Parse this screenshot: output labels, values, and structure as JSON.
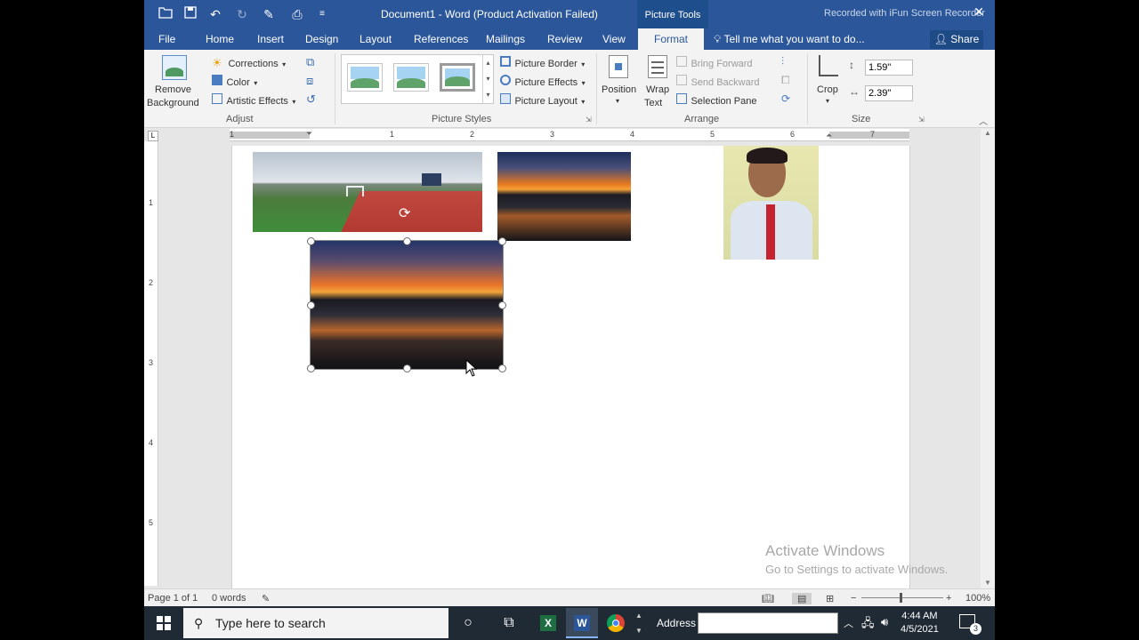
{
  "window": {
    "title": "Document1 - Word (Product Activation Failed)",
    "context_tab_group": "Picture Tools",
    "recorder_overlay": "Recorded with iFun Screen Recorder",
    "close_glyph": "✕"
  },
  "tabs": [
    "File",
    "Home",
    "Insert",
    "Design",
    "Layout",
    "References",
    "Mailings",
    "Review",
    "View",
    "Format"
  ],
  "tell_me": "Tell me what you want to do...",
  "share": "Share",
  "ribbon": {
    "remove_background": [
      "Remove",
      "Background"
    ],
    "corrections": "Corrections",
    "color": "Color",
    "artistic_effects": "Artistic Effects",
    "adjust_label": "Adjust",
    "picture_border": "Picture Border",
    "picture_effects": "Picture Effects",
    "picture_layout": "Picture Layout",
    "picture_styles_label": "Picture Styles",
    "position": "Position",
    "wrap_text": [
      "Wrap",
      "Text"
    ],
    "bring_forward": "Bring Forward",
    "send_backward": "Send Backward",
    "selection_pane": "Selection Pane",
    "arrange_label": "Arrange",
    "crop": "Crop",
    "height": "1.59\"",
    "width": "2.39\"",
    "size_label": "Size"
  },
  "ruler": {
    "h_numbers": [
      "1",
      "1",
      "2",
      "3",
      "4",
      "5",
      "6",
      "7"
    ],
    "v_numbers": [
      "1",
      "2",
      "3",
      "4",
      "5"
    ]
  },
  "status": {
    "page": "Page 1 of 1",
    "words": "0 words",
    "zoom": "100%"
  },
  "watermark": {
    "line1": "Activate Windows",
    "line2": "Go to Settings to activate Windows."
  },
  "taskbar": {
    "search_placeholder": "Type here to search",
    "address_label": "Address",
    "time": "4:44 AM",
    "date": "4/5/2021",
    "notification_count": "3"
  },
  "colors": {
    "word_blue": "#2b579a",
    "ribbon_bg": "#f3f3f3",
    "taskbar": "#1f2a35"
  }
}
